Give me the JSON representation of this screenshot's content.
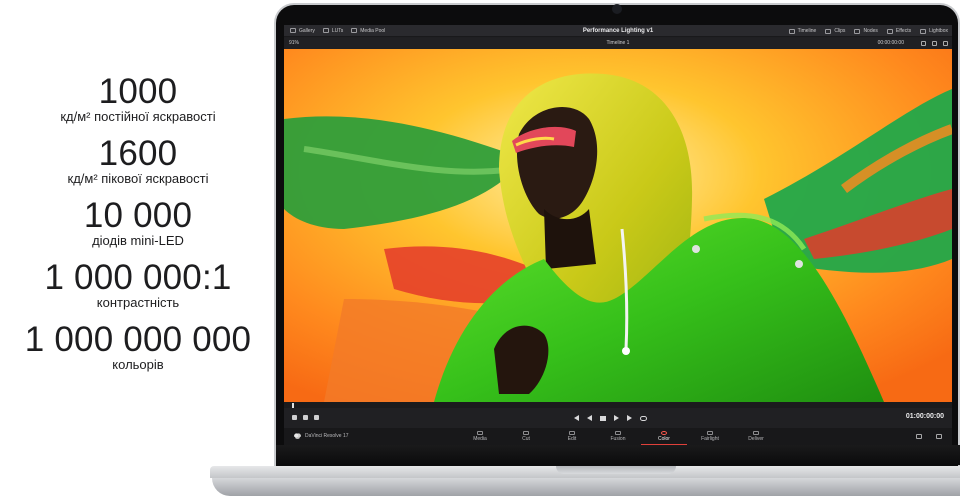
{
  "specs": [
    {
      "value": "1000",
      "caption": "кд/м² постійної яскравості"
    },
    {
      "value": "1600",
      "caption": "кд/м² пікової яскравості"
    },
    {
      "value": "10 000",
      "caption": "діодів mini-LED"
    },
    {
      "value": "1 000 000:1",
      "caption": "контрастність"
    },
    {
      "value": "1 000 000 000",
      "caption": "кольорів"
    }
  ],
  "app": {
    "title": "Performance Lighting v1",
    "left_menu": [
      "Gallery",
      "LUTs",
      "Media Pool"
    ],
    "right_menu": [
      "Timeline",
      "Clips",
      "Nodes",
      "Effects",
      "Lightbox"
    ],
    "zoom": "91%",
    "timeline_name": "Timeline 1",
    "timecode_top": "00:00:00:00",
    "timecode_bottom": "01:00:00:00",
    "brand": "DaVinci Resolve 17",
    "pages": [
      "Media",
      "Cut",
      "Edit",
      "Fusion",
      "Color",
      "Fairlight",
      "Deliver"
    ],
    "active_page": "Color"
  },
  "colors": {
    "accent": "#e0403a",
    "jacket_green": "#3fce1e",
    "hood_yellow": "#d8d41a",
    "background_orange": "#ff8a1e"
  }
}
